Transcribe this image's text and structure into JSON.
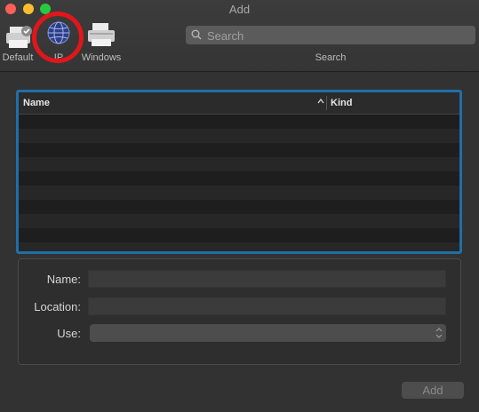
{
  "window": {
    "title": "Add"
  },
  "toolbar": {
    "tools": [
      {
        "label": "Default"
      },
      {
        "label": "IP"
      },
      {
        "label": "Windows"
      }
    ],
    "search": {
      "placeholder": "Search",
      "caption": "Search"
    }
  },
  "printer_list": {
    "columns": {
      "name": "Name",
      "kind": "Kind"
    },
    "rows": []
  },
  "details": {
    "name_label": "Name:",
    "location_label": "Location:",
    "use_label": "Use:",
    "name_value": "",
    "location_value": "",
    "use_value": ""
  },
  "footer": {
    "add_label": "Add"
  },
  "colors": {
    "selection_ring": "#e1161b",
    "focus_border": "#1f6fa8",
    "close": "#fe5f57",
    "minimize": "#febc2e",
    "maximize": "#28c840"
  },
  "icons": [
    "printer-icon",
    "globe-icon",
    "search-icon",
    "sort-ascending-icon",
    "popup-arrows-icon"
  ]
}
